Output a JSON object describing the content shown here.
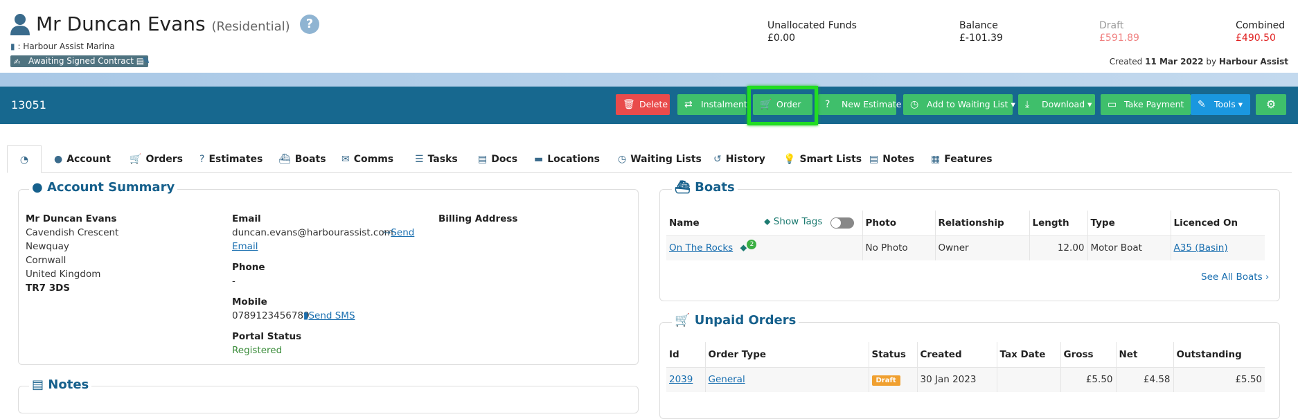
{
  "customer": {
    "title": "Mr Duncan Evans",
    "type": "(Residential)",
    "marina": ": Harbour Assist Marina",
    "status": "Awaiting Signed Contract",
    "help": "?"
  },
  "stats": [
    {
      "label": "Unallocated Funds",
      "value": "£0.00",
      "color": "#222222"
    },
    {
      "label": "Balance",
      "value": "£-101.39",
      "color": "#222222"
    },
    {
      "label": "Draft",
      "value": "£591.89",
      "color": "#f08080"
    },
    {
      "label": "Combined",
      "value": "£490.50",
      "color": "#e02020"
    }
  ],
  "created": {
    "prefix": "Created",
    "date": "11 Mar 2022",
    "by": "by",
    "user": "Harbour Assist"
  },
  "toolbar": {
    "account_number": "13051",
    "buttons": {
      "delete": "Delete",
      "instalment": "Instalment",
      "order": "Order",
      "new_estimate": "New Estimate",
      "waiting_list": "Add to Waiting List",
      "download": "Download",
      "take_payment": "Take Payment",
      "tools": "Tools"
    }
  },
  "tabs": [
    "Account",
    "Orders",
    "Estimates",
    "Boats",
    "Comms",
    "Tasks",
    "Docs",
    "Locations",
    "Waiting Lists",
    "History",
    "Smart Lists",
    "Notes",
    "Features"
  ],
  "account_summary": {
    "title": "Account Summary",
    "address": [
      "Mr Duncan Evans",
      "Cavendish Crescent",
      "Newquay",
      "Cornwall",
      "United Kingdom",
      "TR7 3DS"
    ],
    "email_label": "Email",
    "email": "duncan.evans@harbourassist.com",
    "send_email": "Send",
    "send_email_2": "Email",
    "phone_label": "Phone",
    "phone": "-",
    "mobile_label": "Mobile",
    "mobile": "0789123456789",
    "send_sms": "Send SMS",
    "portal_label": "Portal Status",
    "portal": "Registered",
    "billing_label": "Billing Address"
  },
  "notes": {
    "title": "Notes"
  },
  "boats": {
    "title": "Boats",
    "show_tags": "Show Tags",
    "columns": [
      "Name",
      "Photo",
      "Relationship",
      "Length",
      "Type",
      "Licenced On"
    ],
    "rows": [
      {
        "name": "On The Rocks",
        "tags": "2",
        "photo": "No Photo",
        "relationship": "Owner",
        "length": "12.00",
        "type": "Motor Boat",
        "licenced": "A35 (Basin)"
      }
    ],
    "see_all": "See All Boats"
  },
  "unpaid_orders": {
    "title": "Unpaid Orders",
    "columns": [
      "Id",
      "Order Type",
      "Status",
      "Created",
      "Tax Date",
      "Gross",
      "Net",
      "Outstanding"
    ],
    "rows": [
      {
        "id": "2039",
        "type": "General",
        "status": "Draft",
        "created": "30 Jan 2023",
        "tax_date": "",
        "gross": "£5.50",
        "net": "£4.58",
        "outstanding": "£5.50"
      }
    ]
  }
}
